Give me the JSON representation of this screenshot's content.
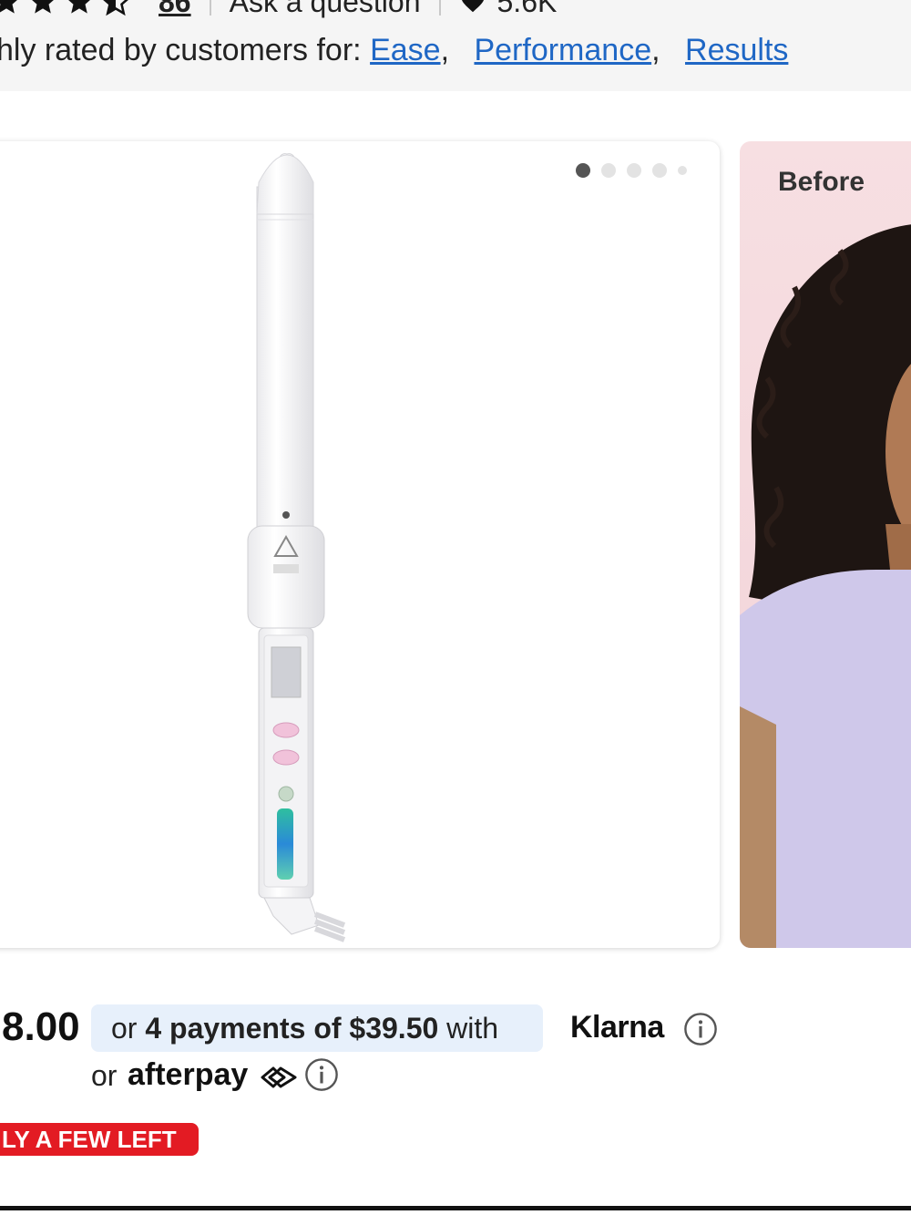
{
  "rating": {
    "review_count": "86",
    "ask_label": "Ask a question",
    "loves_count": "5.6K"
  },
  "highly_rated": {
    "prefix": "hly rated by customers for:",
    "tags": [
      "Ease",
      "Performance",
      "Results"
    ]
  },
  "carousel": {
    "dot_count": 5,
    "active_index": 0,
    "second_card_label": "Before"
  },
  "pricing": {
    "price": "8.00",
    "klarna_prefix": "or",
    "klarna_bold": "4 payments of $39.50",
    "klarna_suffix": "with",
    "klarna_logo": "Klarna",
    "afterpay_prefix": "or",
    "afterpay_logo": "afterpay"
  },
  "stock_badge": "LY A FEW LEFT",
  "colors": {
    "link": "#1f67c5",
    "badge_red": "#e31b23",
    "klarna_bg": "#e7f0fb"
  }
}
